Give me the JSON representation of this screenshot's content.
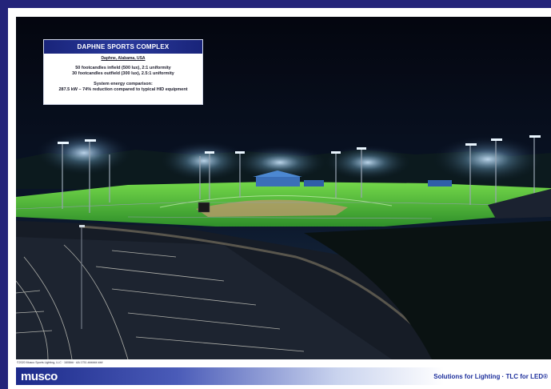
{
  "info_box": {
    "title": "DAPHNE SPORTS COMPLEX",
    "location": "Daphne, Alabama, USA",
    "line1": "50 footcandles infield (500 lux), 2:1 uniformity",
    "line2": "30 footcandles outfield (300 lux), 2.5:1 uniformity",
    "line3": "System energy comparison:",
    "line4": "287.5 kW – 74% reduction compared to typical HID equipment"
  },
  "footer": {
    "small_print": "©2020 Musco Sports Lighting, LLC · 1608##  ·  AA 1751 ###### ###",
    "logo_text": "musco",
    "tagline": "Solutions for Lighting · TLC for LED®"
  },
  "colors": {
    "frame": "#24247a",
    "title_bar": "#19247a",
    "tagline": "#1d2f9c",
    "turf": "#4fbf3a"
  }
}
